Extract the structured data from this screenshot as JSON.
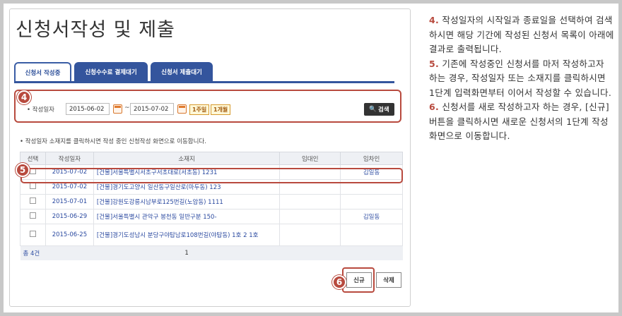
{
  "page": {
    "title": "신청서작성 및 제출",
    "tabs": [
      {
        "label": "신청서 작성중",
        "active": true
      },
      {
        "label": "신청수수료 결제대기",
        "active": false
      },
      {
        "label": "신청서 제출대기",
        "active": false
      }
    ]
  },
  "search": {
    "label": "• 작성일자",
    "start_date": "2015-06-02",
    "tilde": "~",
    "end_date": "2015-07-02",
    "week_btn": "1주일",
    "month_btn": "1개월",
    "search_btn": "검색"
  },
  "notice": "• 작성일자 소재지를 클릭하시면 작성 중인 신청작성 화면으로 이동합니다.",
  "table": {
    "headers": [
      "선택",
      "작성일자",
      "소재지",
      "임대인",
      "임차인"
    ],
    "rows": [
      {
        "date": "2015-07-02",
        "address": "[건물]서울특별시서초구서초대로(서초동) 1231",
        "lessor": "",
        "lessee": "김일동"
      },
      {
        "date": "2015-07-02",
        "address": "[건물]경기도고양시 일산동구일산로(마두동) 123",
        "lessor": "",
        "lessee": ""
      },
      {
        "date": "2015-07-01",
        "address": "[건물]강원도강릉시남부로125번길(노암동) 1111",
        "lessor": "",
        "lessee": ""
      },
      {
        "date": "2015-06-29",
        "address": "[건물]서울특별시 관악구 봉천동 일반구분 150-",
        "lessor": "",
        "lessee": "김일동"
      },
      {
        "date": "2015-06-25",
        "address": "[건물]경기도성남시 분당구야탑남로108번길(야탑동) 1호 2 1호",
        "lessor": "",
        "lessee": ""
      }
    ],
    "total": "총 4건",
    "page": "1"
  },
  "buttons": {
    "new": "신규",
    "delete": "삭제"
  },
  "markers": {
    "m4": "4",
    "m5": "5",
    "m6": "6"
  },
  "description": [
    {
      "num": "4.",
      "text": " 작성일자의 시작일과 종료일을 선택하여 검색하시면 해당 기간에 작성된 신청서 목록이 아래에 결과로 출력됩니다."
    },
    {
      "num": "5.",
      "text": " 기존에 작성중인 신청서를 마저 작성하고자 하는 경우, 작성일자 또는 소재지를 클릭하시면 1단계 입력화면부터 이어서 작성할 수 있습니다."
    },
    {
      "num": "6.",
      "text": " 신청서를 새로 작성하고자 하는 경우, [신규] 버튼을 클릭하시면 새로운 신청서의 1단계 작성화면으로 이동합니다."
    }
  ],
  "colors": {
    "accent": "#34559d",
    "highlight": "#b84a3e"
  }
}
